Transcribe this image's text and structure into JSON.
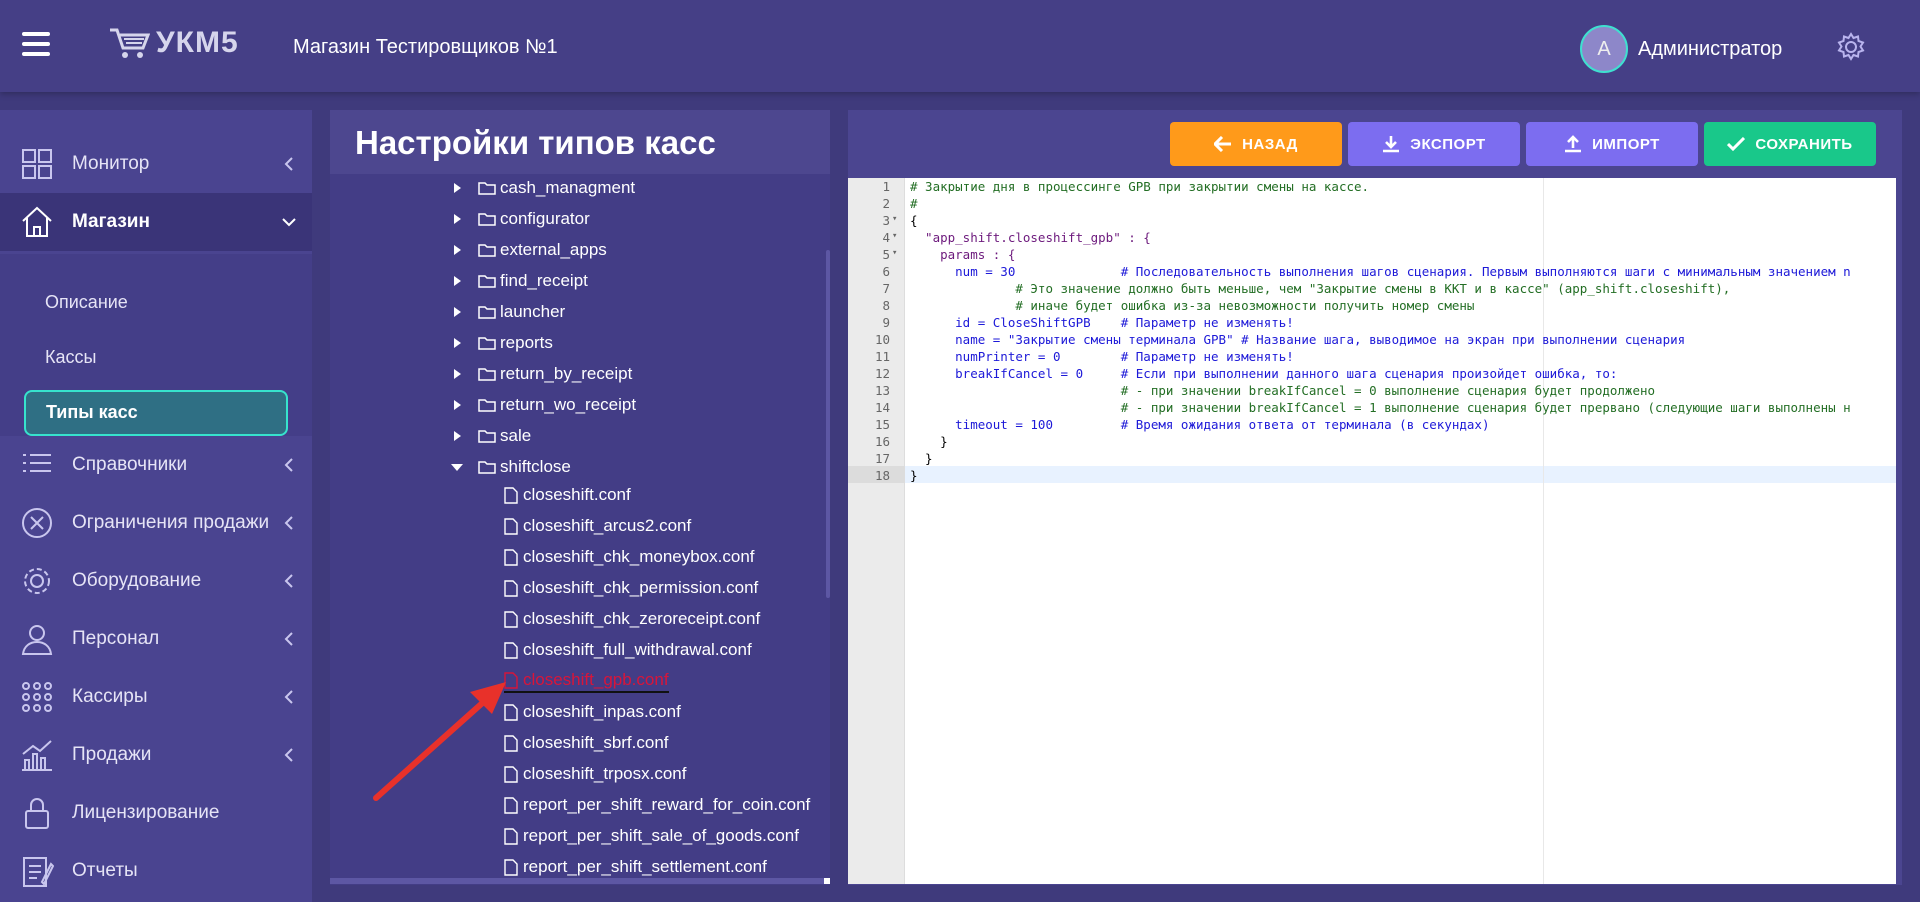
{
  "header": {
    "logo_text": "УКМ5",
    "store_name": "Магазин Тестировщиков №1",
    "avatar_letter": "A",
    "user_name": "Администратор"
  },
  "sidebar": {
    "items": [
      {
        "label": "Монитор",
        "icon": "monitor-grid-icon"
      },
      {
        "label": "Магазин",
        "icon": "store-home-icon"
      },
      {
        "label": "Справочники",
        "icon": "list-icon"
      },
      {
        "label": "Ограничения продажи",
        "icon": "restriction-icon"
      },
      {
        "label": "Оборудование",
        "icon": "gear-icon"
      },
      {
        "label": "Персонал",
        "icon": "person-icon"
      },
      {
        "label": "Кассиры",
        "icon": "dots-grid-icon"
      },
      {
        "label": "Продажи",
        "icon": "sales-chart-icon"
      },
      {
        "label": "Лицензирование",
        "icon": "lock-icon"
      },
      {
        "label": "Отчеты",
        "icon": "report-icon"
      }
    ],
    "submenu": [
      "Описание",
      "Кассы",
      "Типы касс"
    ]
  },
  "tree": {
    "title": "Настройки типов касс",
    "folders": [
      "cash_managment",
      "configurator",
      "external_apps",
      "find_receipt",
      "launcher",
      "reports",
      "return_by_receipt",
      "return_wo_receipt",
      "sale",
      "shiftclose"
    ],
    "files": [
      "closeshift.conf",
      "closeshift_arcus2.conf",
      "closeshift_chk_moneybox.conf",
      "closeshift_chk_permission.conf",
      "closeshift_chk_zeroreceipt.conf",
      "closeshift_full_withdrawal.conf",
      "closeshift_gpb.conf",
      "closeshift_inpas.conf",
      "closeshift_sbrf.conf",
      "closeshift_trposx.conf",
      "report_per_shift_reward_for_coin.conf",
      "report_per_shift_sale_of_goods.conf",
      "report_per_shift_settlement.conf"
    ],
    "selected_file": "closeshift_gpb.conf"
  },
  "toolbar": {
    "back": "НАЗАД",
    "export": "ЭКСПОРТ",
    "import": "ИМПОРТ",
    "save": "СОХРАНИТЬ"
  },
  "editor": {
    "line_numbers": [
      "1",
      "2",
      "3",
      "4",
      "5",
      "6",
      "7",
      "8",
      "9",
      "10",
      "11",
      "12",
      "13",
      "14",
      "15",
      "16",
      "17",
      "18"
    ],
    "lines": [
      "# Закрытие дня в процессинге GPB при закрытии смены на кассе.",
      "#",
      "{",
      "  \"app_shift.closeshift_gpb\" : {",
      "    params : {",
      "      num = 30              # Последовательность выполнения шагов сценария. Первым выполняются шаги с минимальным значением n",
      "              # Это значение должно быть меньше, чем \"Закрытие смены в ККТ и в кассе\" (app_shift.closeshift),",
      "              # иначе будет ошибка из-за невозможности получить номер смены",
      "      id = CloseShiftGPB    # Параметр не изменять!",
      "      name = \"Закрытие смены терминала GPB\" # Название шага, выводимое на экран при выполнении сценария",
      "      numPrinter = 0        # Параметр не изменять!",
      "      breakIfCancel = 0     # Если при выполнении данного шага сценария произойдет ошибка, то:",
      "                            # - при значении breakIfCancel = 0 выполнение сценария будет продолжено",
      "                            # - при значении breakIfCancel = 1 выполнение сценария будет прервано (следующие шаги выполнены н",
      "      timeout = 100         # Время ожидания ответа от терминала (в секундах)",
      "    }",
      "  }",
      "}"
    ]
  }
}
